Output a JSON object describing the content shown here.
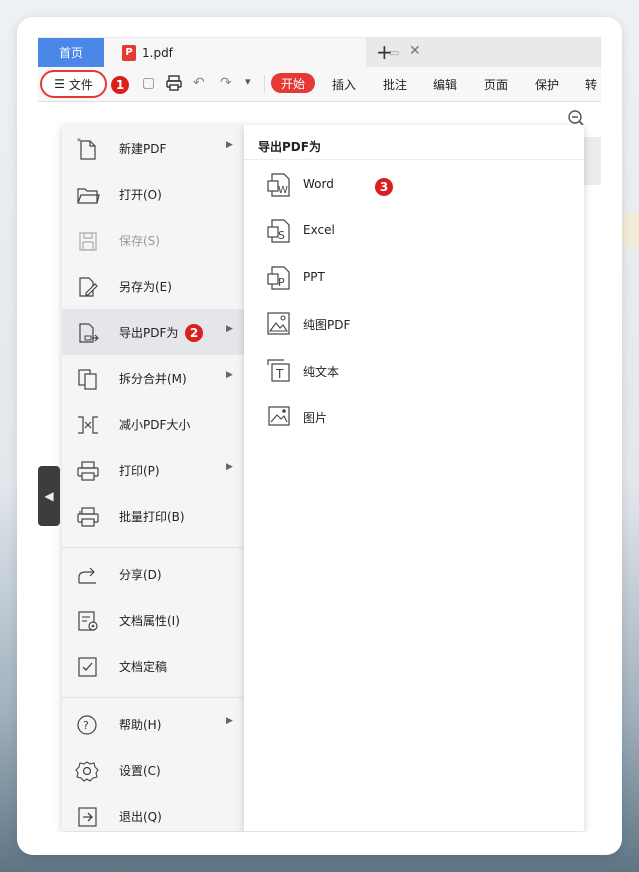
{
  "tabs": {
    "home": "首页",
    "file_name": "1.pdf",
    "add": "+"
  },
  "toolbar": {
    "file_menu_label": "文件",
    "ribbon_tabs": [
      "开始",
      "插入",
      "批注",
      "编辑",
      "页面",
      "保护",
      "转"
    ]
  },
  "badges": {
    "one": "1",
    "two": "2",
    "three": "3"
  },
  "file_menu": {
    "items": [
      {
        "label": "新建PDF",
        "icon": "new-pdf-icon",
        "arrow": true
      },
      {
        "label": "打开(O)",
        "icon": "folder-open-icon",
        "arrow": false
      },
      {
        "label": "保存(S)",
        "icon": "save-icon",
        "arrow": false,
        "disabled": true
      },
      {
        "label": "另存为(E)",
        "icon": "save-as-icon",
        "arrow": false
      },
      {
        "label": "导出PDF为",
        "icon": "export-pdf-icon",
        "arrow": true,
        "highlighted": true
      },
      {
        "label": "拆分合并(M)",
        "icon": "split-merge-icon",
        "arrow": true
      },
      {
        "label": "减小PDF大小",
        "icon": "compress-icon",
        "arrow": false
      },
      {
        "label": "打印(P)",
        "icon": "print-icon",
        "arrow": true
      },
      {
        "label": "批量打印(B)",
        "icon": "batch-print-icon",
        "arrow": false
      },
      {
        "label": "分享(D)",
        "icon": "share-icon",
        "arrow": false
      },
      {
        "label": "文档属性(I)",
        "icon": "doc-properties-icon",
        "arrow": false
      },
      {
        "label": "文档定稿",
        "icon": "finalize-icon",
        "arrow": false
      },
      {
        "label": "帮助(H)",
        "icon": "help-icon",
        "arrow": true
      },
      {
        "label": "设置(C)",
        "icon": "settings-icon",
        "arrow": false
      },
      {
        "label": "退出(Q)",
        "icon": "exit-icon",
        "arrow": false
      }
    ]
  },
  "export_submenu": {
    "title": "导出PDF为",
    "items": [
      {
        "label": "Word",
        "icon": "word-icon"
      },
      {
        "label": "Excel",
        "icon": "excel-icon"
      },
      {
        "label": "PPT",
        "icon": "ppt-icon"
      },
      {
        "label": "纯图PDF",
        "icon": "image-pdf-icon"
      },
      {
        "label": "纯文本",
        "icon": "text-icon"
      },
      {
        "label": "图片",
        "icon": "picture-icon"
      }
    ]
  },
  "colors": {
    "accent_red": "#e53935",
    "home_tab_blue": "#4a87e8",
    "menu_highlight": "#e4e6ea"
  }
}
